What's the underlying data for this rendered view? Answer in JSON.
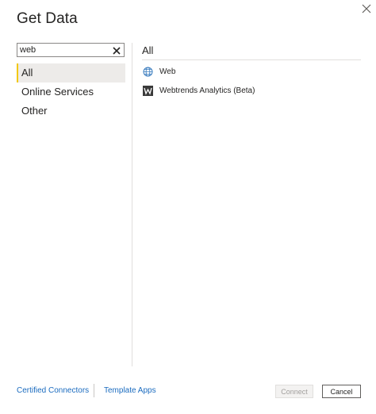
{
  "dialog": {
    "title": "Get Data",
    "close_icon": "close-icon"
  },
  "search": {
    "value": "web",
    "clear_icon": "clear-icon"
  },
  "categories": [
    {
      "label": "All",
      "selected": true
    },
    {
      "label": "Online Services",
      "selected": false
    },
    {
      "label": "Other",
      "selected": false
    }
  ],
  "results": {
    "header": "All",
    "items": [
      {
        "label": "Web",
        "icon": "globe-icon"
      },
      {
        "label": "Webtrends Analytics (Beta)",
        "icon": "webtrends-logo-icon"
      }
    ]
  },
  "footer": {
    "certified_connectors": "Certified Connectors",
    "template_apps": "Template Apps",
    "connect": "Connect",
    "cancel": "Cancel"
  },
  "colors": {
    "accent": "#f2c811",
    "link": "#1a6bbf",
    "selected_bg": "#edebe9"
  }
}
